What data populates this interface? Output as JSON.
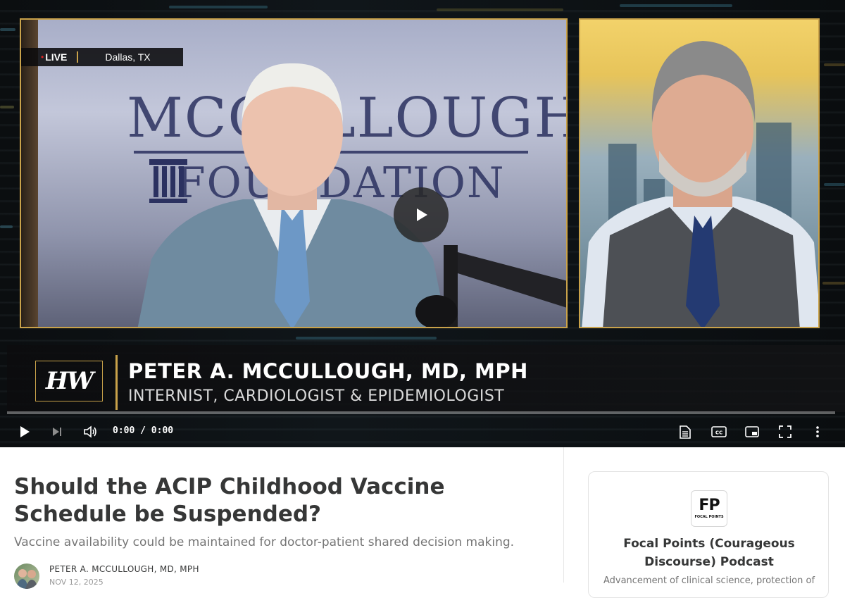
{
  "video": {
    "live_badge": {
      "label": "LIVE",
      "location": "Dallas, TX"
    },
    "backdrop_logo": {
      "line1": "MCCULLOUGH",
      "line2": "FOUNDATION"
    },
    "lower_third": {
      "logo_text": "HW",
      "name": "PETER A. MCCULLOUGH, MD, MPH",
      "role": "INTERNIST, CARDIOLOGIST & EPIDEMIOLOGIST"
    },
    "controls": {
      "time": "0:00 / 0:00",
      "progress": 0,
      "icons": [
        "play-icon",
        "skip-next-icon",
        "volume-icon",
        "transcript-icon",
        "closed-captions-icon",
        "picture-in-picture-icon",
        "fullscreen-icon",
        "more-options-icon"
      ]
    },
    "accent_color": "#c9a24a"
  },
  "article": {
    "title": "Should the ACIP Childhood Vaccine Schedule be Suspended?",
    "subtitle": "Vaccine availability could be maintained for doctor-patient shared decision making.",
    "author": "PETER A. MCCULLOUGH, MD, MPH",
    "date": "NOV 12, 2025"
  },
  "publication": {
    "logo_text": "FP",
    "logo_subtext": "FOCAL POINTS",
    "name": "Focal Points (Courageous Discourse) Podcast",
    "description": "Advancement of clinical science, protection of"
  }
}
